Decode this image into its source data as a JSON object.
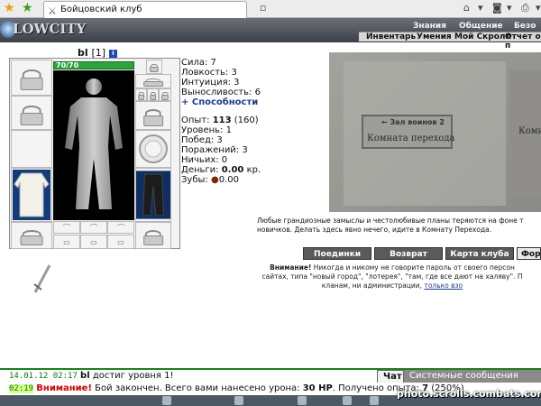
{
  "browser": {
    "tab_title": "Бойцовский клуб"
  },
  "header": {
    "logo": "LOWCITY",
    "menu": [
      "Знания",
      "Общение",
      "Безо"
    ],
    "submenu": [
      "Инвентарь",
      "Умения",
      "Мой Скролл",
      "Отчет о п"
    ]
  },
  "character": {
    "nick": "bl",
    "level": "[1]",
    "info_badge": "i",
    "hp": "70/70",
    "hp_fraction": 1.0
  },
  "stats": {
    "strength": "Сила: 7",
    "agility": "Ловкость: 3",
    "intuition": "Интуиция: 3",
    "endurance": "Выносливость: 6",
    "abilities": "+ Способности"
  },
  "progress": {
    "exp_label": "Опыт: ",
    "exp_value": "113",
    "exp_next": " (160)",
    "level": "Уровень: 1",
    "wins": "Побед: 3",
    "losses": "Поражений: 3",
    "draws": "Ничьих: 0",
    "money_label": "Деньги: ",
    "money_value": "0.00",
    "money_unit": " кр.",
    "teeth_label": "Зубы: ",
    "teeth_value": "0.00"
  },
  "map": {
    "sign1": "← Зал воинов 2",
    "sign2": "Комната перехода",
    "sign3": "Комна"
  },
  "description": "Любые грандиозные замыслы и честолюбивые планы теряются на фоне т новичков. Делать здесь явно нечего, идите в Комнату Перехода.",
  "buttons": {
    "duels": "Поединки",
    "back": "Возврат",
    "club_map": "Карта клуба",
    "forum": "Фору"
  },
  "warning": {
    "bold": "Внимание!",
    "text1": " Никогда и никому не говорите пароль от своего персон",
    "text2": "сайтах, типа \"новый город\", \"лотерея\", \"там, где все дают на халяву\". П",
    "text3": "кланам, ни администрации, ",
    "link": "только взо"
  },
  "chat": {
    "tab_chat": "Чат",
    "tab_system": "Системные сообщения",
    "msg1_time": "14.01.12 02:17",
    "msg1_nick": "bl",
    "msg1_text": " достиг уровня 1!",
    "msg2_time": "02:19",
    "msg2_warn": "Внимание!",
    "msg2_text": " Бой закончен. Всего вами нанесено урона: ",
    "msg2_dmg": "30 HP",
    "msg2_text2": ". Получено опыта: ",
    "msg2_exp": "7",
    "msg2_pct": " (250%)"
  },
  "watermark": "photo.scrolls.combats.com"
}
